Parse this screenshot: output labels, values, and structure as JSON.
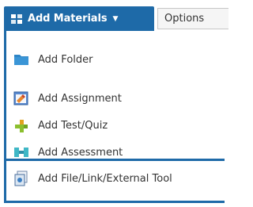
{
  "toolbar": {
    "add_materials_label": "Add Materials",
    "options_label": "Options"
  },
  "menu": {
    "items": [
      {
        "label": "Add Folder",
        "icon": "folder-icon"
      },
      {
        "label": "Add Assignment",
        "icon": "assignment-icon"
      },
      {
        "label": "Add Test/Quiz",
        "icon": "test-quiz-icon"
      },
      {
        "label": "Add Assessment",
        "icon": "assessment-icon"
      },
      {
        "label": "Add File/Link/External Tool",
        "icon": "file-link-icon"
      }
    ]
  },
  "colors": {
    "accent": "#1e6aa8",
    "folder": "#2e86c7",
    "text": "#333333"
  }
}
